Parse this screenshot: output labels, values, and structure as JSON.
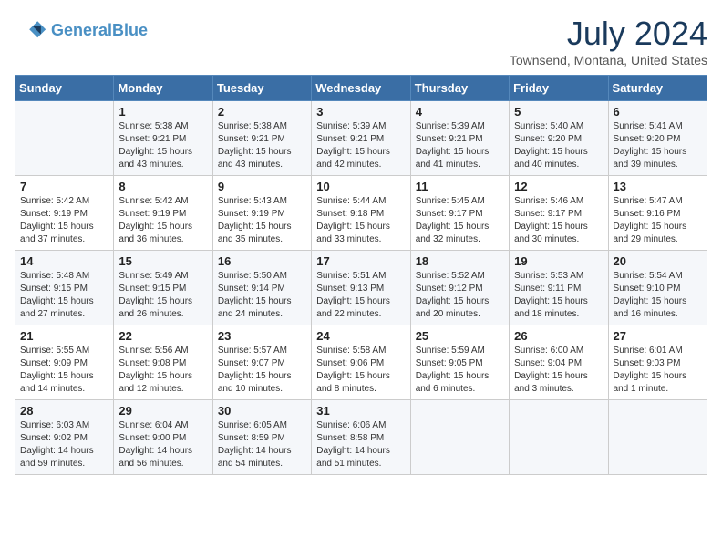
{
  "header": {
    "logo_line1": "General",
    "logo_line2": "Blue",
    "month_year": "July 2024",
    "location": "Townsend, Montana, United States"
  },
  "weekdays": [
    "Sunday",
    "Monday",
    "Tuesday",
    "Wednesday",
    "Thursday",
    "Friday",
    "Saturday"
  ],
  "weeks": [
    [
      {
        "day": "",
        "sunrise": "",
        "sunset": "",
        "daylight": ""
      },
      {
        "day": "1",
        "sunrise": "Sunrise: 5:38 AM",
        "sunset": "Sunset: 9:21 PM",
        "daylight": "Daylight: 15 hours and 43 minutes."
      },
      {
        "day": "2",
        "sunrise": "Sunrise: 5:38 AM",
        "sunset": "Sunset: 9:21 PM",
        "daylight": "Daylight: 15 hours and 43 minutes."
      },
      {
        "day": "3",
        "sunrise": "Sunrise: 5:39 AM",
        "sunset": "Sunset: 9:21 PM",
        "daylight": "Daylight: 15 hours and 42 minutes."
      },
      {
        "day": "4",
        "sunrise": "Sunrise: 5:39 AM",
        "sunset": "Sunset: 9:21 PM",
        "daylight": "Daylight: 15 hours and 41 minutes."
      },
      {
        "day": "5",
        "sunrise": "Sunrise: 5:40 AM",
        "sunset": "Sunset: 9:20 PM",
        "daylight": "Daylight: 15 hours and 40 minutes."
      },
      {
        "day": "6",
        "sunrise": "Sunrise: 5:41 AM",
        "sunset": "Sunset: 9:20 PM",
        "daylight": "Daylight: 15 hours and 39 minutes."
      }
    ],
    [
      {
        "day": "7",
        "sunrise": "Sunrise: 5:42 AM",
        "sunset": "Sunset: 9:19 PM",
        "daylight": "Daylight: 15 hours and 37 minutes."
      },
      {
        "day": "8",
        "sunrise": "Sunrise: 5:42 AM",
        "sunset": "Sunset: 9:19 PM",
        "daylight": "Daylight: 15 hours and 36 minutes."
      },
      {
        "day": "9",
        "sunrise": "Sunrise: 5:43 AM",
        "sunset": "Sunset: 9:19 PM",
        "daylight": "Daylight: 15 hours and 35 minutes."
      },
      {
        "day": "10",
        "sunrise": "Sunrise: 5:44 AM",
        "sunset": "Sunset: 9:18 PM",
        "daylight": "Daylight: 15 hours and 33 minutes."
      },
      {
        "day": "11",
        "sunrise": "Sunrise: 5:45 AM",
        "sunset": "Sunset: 9:17 PM",
        "daylight": "Daylight: 15 hours and 32 minutes."
      },
      {
        "day": "12",
        "sunrise": "Sunrise: 5:46 AM",
        "sunset": "Sunset: 9:17 PM",
        "daylight": "Daylight: 15 hours and 30 minutes."
      },
      {
        "day": "13",
        "sunrise": "Sunrise: 5:47 AM",
        "sunset": "Sunset: 9:16 PM",
        "daylight": "Daylight: 15 hours and 29 minutes."
      }
    ],
    [
      {
        "day": "14",
        "sunrise": "Sunrise: 5:48 AM",
        "sunset": "Sunset: 9:15 PM",
        "daylight": "Daylight: 15 hours and 27 minutes."
      },
      {
        "day": "15",
        "sunrise": "Sunrise: 5:49 AM",
        "sunset": "Sunset: 9:15 PM",
        "daylight": "Daylight: 15 hours and 26 minutes."
      },
      {
        "day": "16",
        "sunrise": "Sunrise: 5:50 AM",
        "sunset": "Sunset: 9:14 PM",
        "daylight": "Daylight: 15 hours and 24 minutes."
      },
      {
        "day": "17",
        "sunrise": "Sunrise: 5:51 AM",
        "sunset": "Sunset: 9:13 PM",
        "daylight": "Daylight: 15 hours and 22 minutes."
      },
      {
        "day": "18",
        "sunrise": "Sunrise: 5:52 AM",
        "sunset": "Sunset: 9:12 PM",
        "daylight": "Daylight: 15 hours and 20 minutes."
      },
      {
        "day": "19",
        "sunrise": "Sunrise: 5:53 AM",
        "sunset": "Sunset: 9:11 PM",
        "daylight": "Daylight: 15 hours and 18 minutes."
      },
      {
        "day": "20",
        "sunrise": "Sunrise: 5:54 AM",
        "sunset": "Sunset: 9:10 PM",
        "daylight": "Daylight: 15 hours and 16 minutes."
      }
    ],
    [
      {
        "day": "21",
        "sunrise": "Sunrise: 5:55 AM",
        "sunset": "Sunset: 9:09 PM",
        "daylight": "Daylight: 15 hours and 14 minutes."
      },
      {
        "day": "22",
        "sunrise": "Sunrise: 5:56 AM",
        "sunset": "Sunset: 9:08 PM",
        "daylight": "Daylight: 15 hours and 12 minutes."
      },
      {
        "day": "23",
        "sunrise": "Sunrise: 5:57 AM",
        "sunset": "Sunset: 9:07 PM",
        "daylight": "Daylight: 15 hours and 10 minutes."
      },
      {
        "day": "24",
        "sunrise": "Sunrise: 5:58 AM",
        "sunset": "Sunset: 9:06 PM",
        "daylight": "Daylight: 15 hours and 8 minutes."
      },
      {
        "day": "25",
        "sunrise": "Sunrise: 5:59 AM",
        "sunset": "Sunset: 9:05 PM",
        "daylight": "Daylight: 15 hours and 6 minutes."
      },
      {
        "day": "26",
        "sunrise": "Sunrise: 6:00 AM",
        "sunset": "Sunset: 9:04 PM",
        "daylight": "Daylight: 15 hours and 3 minutes."
      },
      {
        "day": "27",
        "sunrise": "Sunrise: 6:01 AM",
        "sunset": "Sunset: 9:03 PM",
        "daylight": "Daylight: 15 hours and 1 minute."
      }
    ],
    [
      {
        "day": "28",
        "sunrise": "Sunrise: 6:03 AM",
        "sunset": "Sunset: 9:02 PM",
        "daylight": "Daylight: 14 hours and 59 minutes."
      },
      {
        "day": "29",
        "sunrise": "Sunrise: 6:04 AM",
        "sunset": "Sunset: 9:00 PM",
        "daylight": "Daylight: 14 hours and 56 minutes."
      },
      {
        "day": "30",
        "sunrise": "Sunrise: 6:05 AM",
        "sunset": "Sunset: 8:59 PM",
        "daylight": "Daylight: 14 hours and 54 minutes."
      },
      {
        "day": "31",
        "sunrise": "Sunrise: 6:06 AM",
        "sunset": "Sunset: 8:58 PM",
        "daylight": "Daylight: 14 hours and 51 minutes."
      },
      {
        "day": "",
        "sunrise": "",
        "sunset": "",
        "daylight": ""
      },
      {
        "day": "",
        "sunrise": "",
        "sunset": "",
        "daylight": ""
      },
      {
        "day": "",
        "sunrise": "",
        "sunset": "",
        "daylight": ""
      }
    ]
  ]
}
